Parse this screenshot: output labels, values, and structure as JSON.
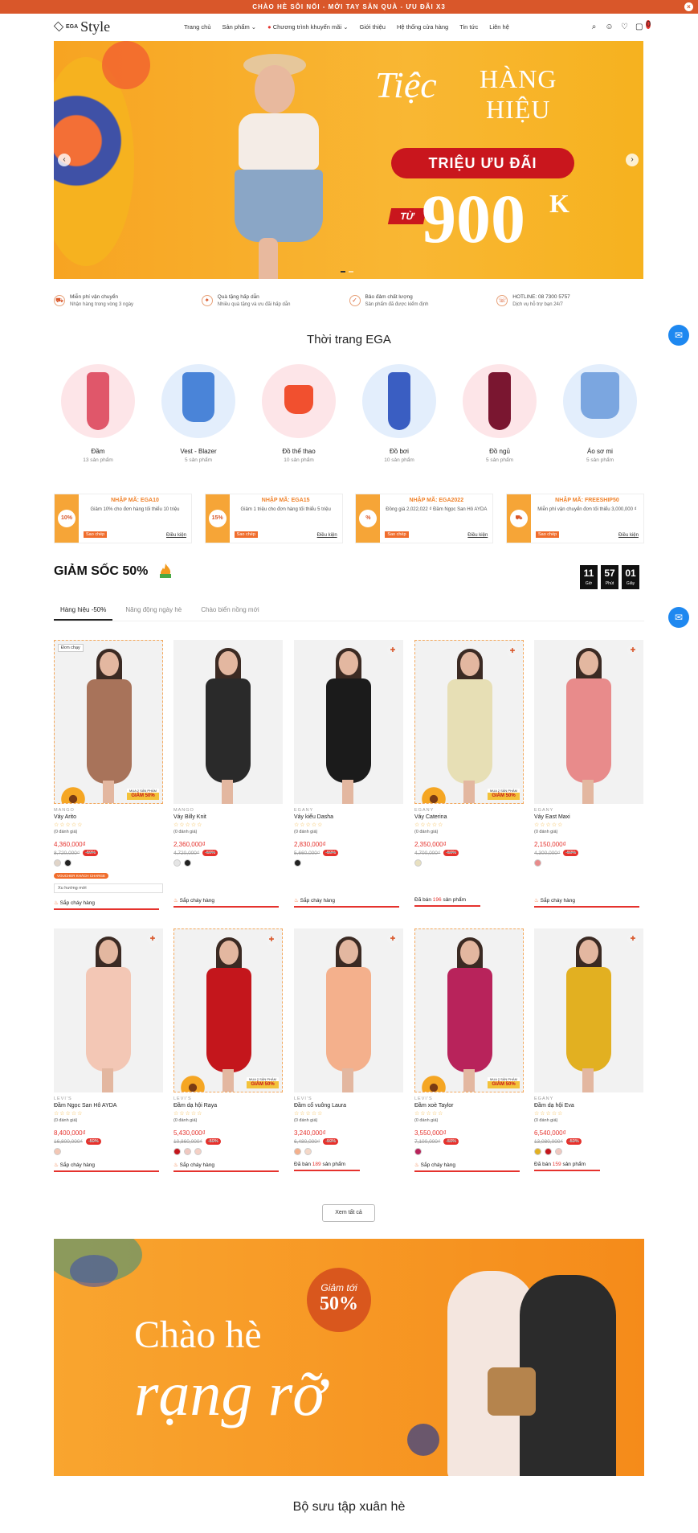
{
  "topbar": {
    "text": "CHÀO HÈ SÔI NỔI - MỞI TAY SĂN QUÀ - ƯU ĐÃI X3",
    "close": "×"
  },
  "logo": {
    "small": "EGA",
    "big": "Style"
  },
  "nav": [
    "Trang chủ",
    "Sản phẩm",
    "Chương trình khuyến mãi",
    "Giới thiệu",
    "Hệ thống cửa hàng",
    "Tin tức",
    "Liên hệ"
  ],
  "cart_count": "0",
  "hero": {
    "script": "Tiệc",
    "line1": "HÀNG",
    "line2": "HIỆU",
    "pill": "TRIỆU ƯU ĐÃI",
    "from": "TỪ",
    "amount": "900",
    "unit": "K"
  },
  "features": [
    {
      "a": "Miễn phí vận chuyển",
      "b": "Nhận hàng trong vòng 3 ngày"
    },
    {
      "a": "Quà tặng hấp dẫn",
      "b": "Nhiều quà tặng và ưu đãi hấp dẫn"
    },
    {
      "a": "Bảo đảm chất lượng",
      "b": "Sản phẩm đã được kiểm định"
    },
    {
      "a": "HOTLINE: 08 7300 5757",
      "b": "Dịch vụ hỗ trợ bạn 24/7"
    }
  ],
  "category_title": "Thời trang EGA",
  "categories": [
    {
      "name": "Đầm",
      "count": "13 sản phẩm"
    },
    {
      "name": "Vest - Blazer",
      "count": "5 sản phẩm"
    },
    {
      "name": "Đồ thể thao",
      "count": "10 sản phẩm"
    },
    {
      "name": "Đồ bơi",
      "count": "10 sản phẩm"
    },
    {
      "name": "Đồ ngủ",
      "count": "5 sản phẩm"
    },
    {
      "name": "Áo sơ mi",
      "count": "5 sản phẩm"
    }
  ],
  "coupons": [
    {
      "badge": "10%",
      "code": "NHẬP MÃ: EGA10",
      "desc": "Giảm 10% cho đơn hàng tối thiểu 10 triệu",
      "copy": "Sao chép",
      "cond": "Điều kiện"
    },
    {
      "badge": "15%",
      "code": "NHẬP MÃ: EGA15",
      "desc": "Giảm 1 triệu cho đơn hàng tối thiểu 5 triệu",
      "copy": "Sao chép",
      "cond": "Điều kiện"
    },
    {
      "badge": "%",
      "code": "NHẬP MÃ: EGA2022",
      "desc": "Đồng giá 2,022,022 ₫ Đầm Ngọc San Hô AYDA",
      "copy": "Sao chép",
      "cond": "Điều kiện"
    },
    {
      "badge": "",
      "code": "NHẬP MÃ: FREESHIP50",
      "desc": "Miễn phí vận chuyển đơn tối thiểu 3,000,000 ₫",
      "copy": "Sao chép",
      "cond": "Điều kiện"
    }
  ],
  "flash": {
    "title": "GIẢM SỐC 50%",
    "timer": [
      {
        "v": "11",
        "l": "Giờ"
      },
      {
        "v": "57",
        "l": "Phút"
      },
      {
        "v": "01",
        "l": "Giây"
      }
    ]
  },
  "tabs": [
    "Hàng hiệu -50%",
    "Năng động ngày hè",
    "Chào biển nồng mới"
  ],
  "products": [
    {
      "brand": "MANGO",
      "name": "Váy Arito",
      "rev": "(0 đánh giá)",
      "price": "4,360,000₫",
      "old": "8,720,000₫",
      "off": "-50%",
      "hot": "Sắp cháy hàng",
      "color": "#a8735a",
      "tag": "Đơn chạy",
      "border": true,
      "sale": true,
      "swatches": [
        "#e0d4c8",
        "#222"
      ],
      "promo": "VOUCHER KHÁCH CHARGE",
      "option": "Xu hướng mới"
    },
    {
      "brand": "MANGO",
      "name": "Váy Billy Knit",
      "rev": "(0 đánh giá)",
      "price": "2,360,000₫",
      "old": "4,720,000₫",
      "off": "-50%",
      "hot": "Sắp cháy hàng",
      "color": "#2a2a2a",
      "swatches": [
        "#e5e5e5",
        "#222"
      ]
    },
    {
      "brand": "EGANY",
      "name": "Váy kiểu Dasha",
      "rev": "(0 đánh giá)",
      "price": "2,830,000₫",
      "old": "5,660,000₫",
      "off": "-50%",
      "hot": "Sắp cháy hàng",
      "color": "#1b1b1b",
      "gift": true,
      "swatches": [
        "#222"
      ]
    },
    {
      "brand": "EGANY",
      "name": "Váy Caterina",
      "rev": "(0 đánh giá)",
      "price": "2,350,000₫",
      "old": "4,700,000₫",
      "off": "-50%",
      "hot": "Đã bán 196 sản phẩm",
      "hotNum": "196",
      "color": "#e7dfb5",
      "border": true,
      "sale": true,
      "gift": true,
      "swatches": [
        "#e8e0c0"
      ]
    },
    {
      "brand": "EGANY",
      "name": "Váy East Maxi",
      "rev": "(0 đánh giá)",
      "price": "2,150,000₫",
      "old": "4,300,000₫",
      "off": "-50%",
      "hot": "Sắp cháy hàng",
      "color": "#e88b8b",
      "gift": true,
      "swatches": [
        "#e88b8b"
      ]
    },
    {
      "brand": "LEVI'S",
      "name": "Đầm Ngọc San Hô AYDA",
      "rev": "(0 đánh giá)",
      "price": "8,400,000₫",
      "old": "16,800,000₫",
      "off": "-50%",
      "hot": "Sắp cháy hàng",
      "color": "#f3c7b5",
      "gift": true,
      "swatches": [
        "#f3c7b5"
      ]
    },
    {
      "brand": "LEVI'S",
      "name": "Đầm dạ hội Raya",
      "rev": "(0 đánh giá)",
      "price": "5,430,000₫",
      "old": "10,860,000₫",
      "off": "-50%",
      "hot": "Sắp cháy hàng",
      "color": "#c4161c",
      "border": true,
      "sale": true,
      "gift": true,
      "swatches": [
        "#c4161c",
        "#f0c8c0",
        "#f5d0c5"
      ]
    },
    {
      "brand": "LEVI'S",
      "name": "Đầm cổ vuông Laura",
      "rev": "(0 đánh giá)",
      "price": "3,240,000₫",
      "old": "6,480,000₫",
      "off": "-50%",
      "hot": "Đã bán 189 sản phẩm",
      "hotNum": "189",
      "color": "#f4b08c",
      "gift": true,
      "swatches": [
        "#f4b08c",
        "#f5d8c8"
      ]
    },
    {
      "brand": "LEVI'S",
      "name": "Đầm xoè Taylor",
      "rev": "(0 đánh giá)",
      "price": "3,550,000₫",
      "old": "7,100,000₫",
      "off": "-50%",
      "hot": "Sắp cháy hàng",
      "color": "#b8235b",
      "border": true,
      "sale": true,
      "swatches": [
        "#b8235b"
      ]
    },
    {
      "brand": "EGANY",
      "name": "Đầm dạ hội Eva",
      "rev": "(0 đánh giá)",
      "price": "6,540,000₫",
      "old": "13,080,000₫",
      "off": "-50%",
      "hot": "Đã bán 159 sản phẩm",
      "hotNum": "159",
      "color": "#e2b021",
      "gift": true,
      "swatches": [
        "#e2b021",
        "#c4161c",
        "#f0c8c0"
      ]
    }
  ],
  "sale_small": "MUA 2 SẢN PHẨM",
  "sale_big": "GIẢM 50%",
  "stars": "☆☆☆☆☆",
  "view_all": "Xem tất cả",
  "banner2": {
    "badge_small": "Giảm tới",
    "badge_big": "50%",
    "line1": "Chào hè",
    "line2": "rạng rỡ"
  },
  "collection_title": "Bộ sưu tập xuân hè"
}
